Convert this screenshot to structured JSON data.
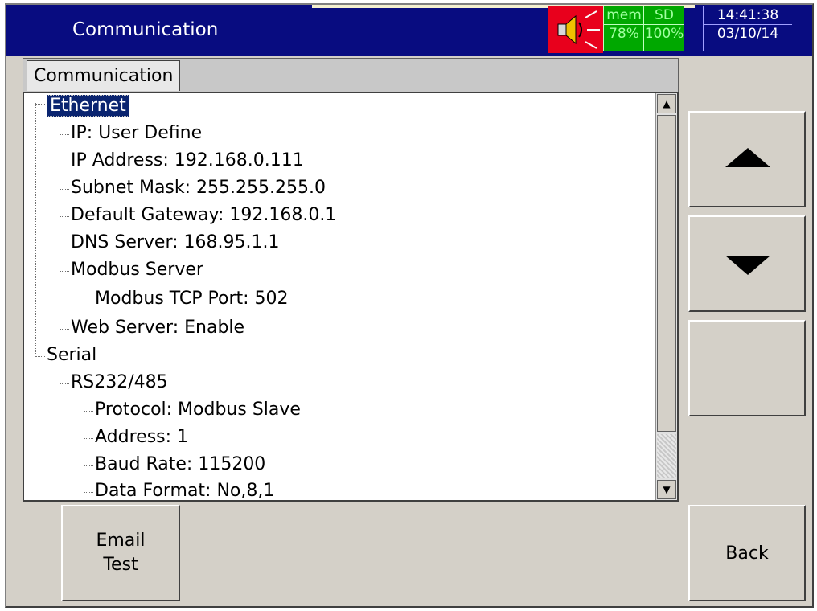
{
  "header": {
    "title": "Communication",
    "speaker_icon": "speaker-icon",
    "mem_label": "mem",
    "mem_value": "78%",
    "sd_label": "SD",
    "sd_value": "100%",
    "time": "14:41:38",
    "date": "03/10/14",
    "colors": {
      "titlebar": "#080c80",
      "alarm": "#e8001c",
      "status_ok": "#00a800"
    }
  },
  "tabs": [
    {
      "label": "Communication",
      "selected": true
    }
  ],
  "tree": {
    "ethernet": "Ethernet",
    "ip_mode": "IP: User Define",
    "ip_address": "IP Address: 192.168.0.111",
    "subnet": "Subnet Mask: 255.255.255.0",
    "gateway": "Default Gateway: 192.168.0.1",
    "dns": "DNS Server: 168.95.1.1",
    "modbus_server": "Modbus Server",
    "modbus_port": "Modbus TCP Port: 502",
    "web_server": "Web Server: Enable",
    "serial": "Serial",
    "rs232": "RS232/485",
    "protocol": "Protocol: Modbus Slave",
    "address": "Address: 1",
    "baud": "Baud Rate: 115200",
    "data_format": "Data Format: No,8,1"
  },
  "buttons": {
    "email_line1": "Email",
    "email_line2": "Test",
    "back": "Back",
    "up_icon": "triangle-up-icon",
    "down_icon": "triangle-down-icon"
  }
}
